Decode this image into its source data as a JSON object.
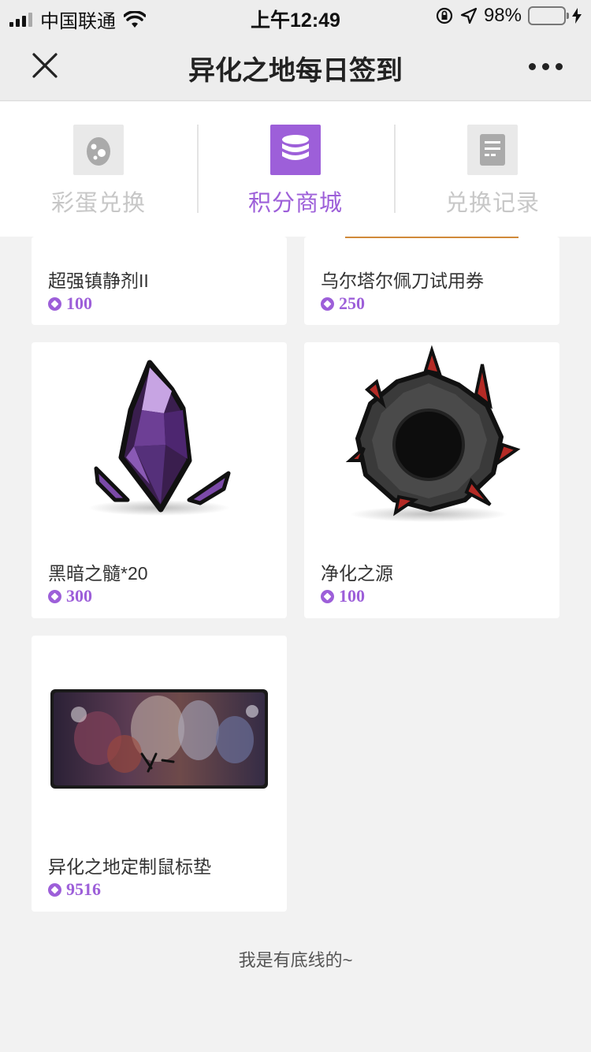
{
  "status_bar": {
    "carrier": "中国联通",
    "time": "上午12:49",
    "battery": "98%",
    "battery_level": 0.98
  },
  "nav": {
    "title": "异化之地每日签到"
  },
  "tabs": [
    {
      "label": "彩蛋兑换",
      "icon": "egg-icon",
      "active": false
    },
    {
      "label": "积分商城",
      "icon": "coin-stack-icon",
      "active": true
    },
    {
      "label": "兑换记录",
      "icon": "document-icon",
      "active": false
    }
  ],
  "products": [
    {
      "name": "超强镇静剂II",
      "price": "100"
    },
    {
      "name": "乌尔塔尔佩刀试用券",
      "price": "250"
    },
    {
      "name": "黑暗之髓*20",
      "price": "300",
      "image": "purple-crystal-icon"
    },
    {
      "name": "净化之源",
      "price": "100",
      "image": "dark-gear-icon"
    },
    {
      "name": "异化之地定制鼠标垫",
      "price": "9516",
      "image": "mousepad-image"
    }
  ],
  "footer": {
    "note": "我是有底线的~"
  },
  "colors": {
    "accent": "#9d5fd9",
    "background": "#f2f2f2",
    "battery": "#4cd964"
  }
}
